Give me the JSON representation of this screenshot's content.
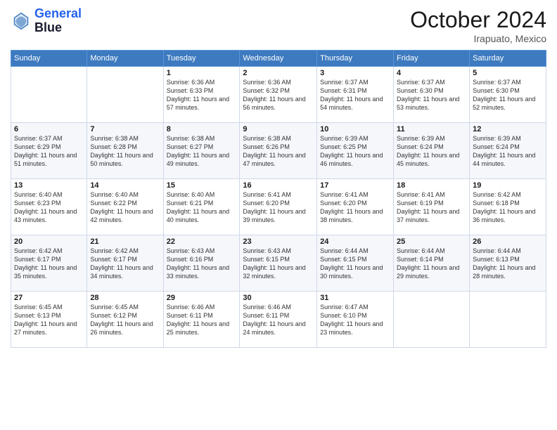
{
  "header": {
    "logo_line1": "General",
    "logo_line2": "Blue",
    "month": "October 2024",
    "location": "Irapuato, Mexico"
  },
  "days_of_week": [
    "Sunday",
    "Monday",
    "Tuesday",
    "Wednesday",
    "Thursday",
    "Friday",
    "Saturday"
  ],
  "weeks": [
    [
      {
        "day": "",
        "sunrise": "",
        "sunset": "",
        "daylight": ""
      },
      {
        "day": "",
        "sunrise": "",
        "sunset": "",
        "daylight": ""
      },
      {
        "day": "1",
        "sunrise": "Sunrise: 6:36 AM",
        "sunset": "Sunset: 6:33 PM",
        "daylight": "Daylight: 11 hours and 57 minutes."
      },
      {
        "day": "2",
        "sunrise": "Sunrise: 6:36 AM",
        "sunset": "Sunset: 6:32 PM",
        "daylight": "Daylight: 11 hours and 56 minutes."
      },
      {
        "day": "3",
        "sunrise": "Sunrise: 6:37 AM",
        "sunset": "Sunset: 6:31 PM",
        "daylight": "Daylight: 11 hours and 54 minutes."
      },
      {
        "day": "4",
        "sunrise": "Sunrise: 6:37 AM",
        "sunset": "Sunset: 6:30 PM",
        "daylight": "Daylight: 11 hours and 53 minutes."
      },
      {
        "day": "5",
        "sunrise": "Sunrise: 6:37 AM",
        "sunset": "Sunset: 6:30 PM",
        "daylight": "Daylight: 11 hours and 52 minutes."
      }
    ],
    [
      {
        "day": "6",
        "sunrise": "Sunrise: 6:37 AM",
        "sunset": "Sunset: 6:29 PM",
        "daylight": "Daylight: 11 hours and 51 minutes."
      },
      {
        "day": "7",
        "sunrise": "Sunrise: 6:38 AM",
        "sunset": "Sunset: 6:28 PM",
        "daylight": "Daylight: 11 hours and 50 minutes."
      },
      {
        "day": "8",
        "sunrise": "Sunrise: 6:38 AM",
        "sunset": "Sunset: 6:27 PM",
        "daylight": "Daylight: 11 hours and 49 minutes."
      },
      {
        "day": "9",
        "sunrise": "Sunrise: 6:38 AM",
        "sunset": "Sunset: 6:26 PM",
        "daylight": "Daylight: 11 hours and 47 minutes."
      },
      {
        "day": "10",
        "sunrise": "Sunrise: 6:39 AM",
        "sunset": "Sunset: 6:25 PM",
        "daylight": "Daylight: 11 hours and 46 minutes."
      },
      {
        "day": "11",
        "sunrise": "Sunrise: 6:39 AM",
        "sunset": "Sunset: 6:24 PM",
        "daylight": "Daylight: 11 hours and 45 minutes."
      },
      {
        "day": "12",
        "sunrise": "Sunrise: 6:39 AM",
        "sunset": "Sunset: 6:24 PM",
        "daylight": "Daylight: 11 hours and 44 minutes."
      }
    ],
    [
      {
        "day": "13",
        "sunrise": "Sunrise: 6:40 AM",
        "sunset": "Sunset: 6:23 PM",
        "daylight": "Daylight: 11 hours and 43 minutes."
      },
      {
        "day": "14",
        "sunrise": "Sunrise: 6:40 AM",
        "sunset": "Sunset: 6:22 PM",
        "daylight": "Daylight: 11 hours and 42 minutes."
      },
      {
        "day": "15",
        "sunrise": "Sunrise: 6:40 AM",
        "sunset": "Sunset: 6:21 PM",
        "daylight": "Daylight: 11 hours and 40 minutes."
      },
      {
        "day": "16",
        "sunrise": "Sunrise: 6:41 AM",
        "sunset": "Sunset: 6:20 PM",
        "daylight": "Daylight: 11 hours and 39 minutes."
      },
      {
        "day": "17",
        "sunrise": "Sunrise: 6:41 AM",
        "sunset": "Sunset: 6:20 PM",
        "daylight": "Daylight: 11 hours and 38 minutes."
      },
      {
        "day": "18",
        "sunrise": "Sunrise: 6:41 AM",
        "sunset": "Sunset: 6:19 PM",
        "daylight": "Daylight: 11 hours and 37 minutes."
      },
      {
        "day": "19",
        "sunrise": "Sunrise: 6:42 AM",
        "sunset": "Sunset: 6:18 PM",
        "daylight": "Daylight: 11 hours and 36 minutes."
      }
    ],
    [
      {
        "day": "20",
        "sunrise": "Sunrise: 6:42 AM",
        "sunset": "Sunset: 6:17 PM",
        "daylight": "Daylight: 11 hours and 35 minutes."
      },
      {
        "day": "21",
        "sunrise": "Sunrise: 6:42 AM",
        "sunset": "Sunset: 6:17 PM",
        "daylight": "Daylight: 11 hours and 34 minutes."
      },
      {
        "day": "22",
        "sunrise": "Sunrise: 6:43 AM",
        "sunset": "Sunset: 6:16 PM",
        "daylight": "Daylight: 11 hours and 33 minutes."
      },
      {
        "day": "23",
        "sunrise": "Sunrise: 6:43 AM",
        "sunset": "Sunset: 6:15 PM",
        "daylight": "Daylight: 11 hours and 32 minutes."
      },
      {
        "day": "24",
        "sunrise": "Sunrise: 6:44 AM",
        "sunset": "Sunset: 6:15 PM",
        "daylight": "Daylight: 11 hours and 30 minutes."
      },
      {
        "day": "25",
        "sunrise": "Sunrise: 6:44 AM",
        "sunset": "Sunset: 6:14 PM",
        "daylight": "Daylight: 11 hours and 29 minutes."
      },
      {
        "day": "26",
        "sunrise": "Sunrise: 6:44 AM",
        "sunset": "Sunset: 6:13 PM",
        "daylight": "Daylight: 11 hours and 28 minutes."
      }
    ],
    [
      {
        "day": "27",
        "sunrise": "Sunrise: 6:45 AM",
        "sunset": "Sunset: 6:13 PM",
        "daylight": "Daylight: 11 hours and 27 minutes."
      },
      {
        "day": "28",
        "sunrise": "Sunrise: 6:45 AM",
        "sunset": "Sunset: 6:12 PM",
        "daylight": "Daylight: 11 hours and 26 minutes."
      },
      {
        "day": "29",
        "sunrise": "Sunrise: 6:46 AM",
        "sunset": "Sunset: 6:11 PM",
        "daylight": "Daylight: 11 hours and 25 minutes."
      },
      {
        "day": "30",
        "sunrise": "Sunrise: 6:46 AM",
        "sunset": "Sunset: 6:11 PM",
        "daylight": "Daylight: 11 hours and 24 minutes."
      },
      {
        "day": "31",
        "sunrise": "Sunrise: 6:47 AM",
        "sunset": "Sunset: 6:10 PM",
        "daylight": "Daylight: 11 hours and 23 minutes."
      },
      {
        "day": "",
        "sunrise": "",
        "sunset": "",
        "daylight": ""
      },
      {
        "day": "",
        "sunrise": "",
        "sunset": "",
        "daylight": ""
      }
    ]
  ]
}
